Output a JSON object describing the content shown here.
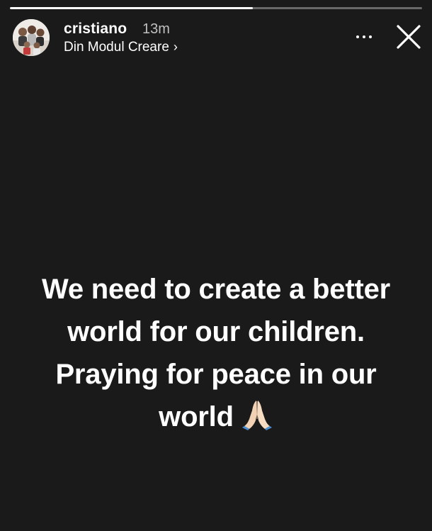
{
  "story": {
    "progress": 0.59,
    "background_color": "#1a1a1a"
  },
  "header": {
    "username": "cristiano",
    "time_ago": "13m",
    "source_link": "Din Modul Creare",
    "source_chevron": "›",
    "more_icon": "more-horizontal-icon",
    "close_icon": "close-icon"
  },
  "content": {
    "lines": [
      "We need to create a better",
      "world for our children.",
      "Praying for peace in our",
      "world"
    ],
    "emoji": "folded-hands-icon"
  }
}
